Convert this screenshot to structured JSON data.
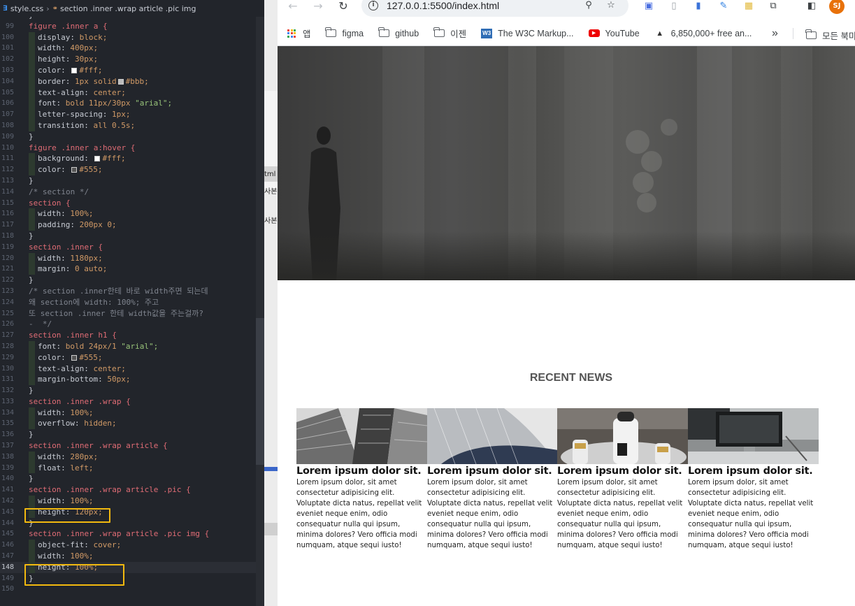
{
  "editor": {
    "breadcrumb": {
      "file": "style.css",
      "selector": "section .inner .wrap article .pic img"
    },
    "lines": [
      {
        "n": "98",
        "text": "}"
      },
      {
        "n": "99",
        "sel": "figure .inner a {"
      },
      {
        "n": "100",
        "prop": "display:",
        "val": "block;"
      },
      {
        "n": "101",
        "prop": "width:",
        "val": "400px;"
      },
      {
        "n": "102",
        "prop": "height:",
        "val": "30px;"
      },
      {
        "n": "103",
        "prop": "color:",
        "swatch": "#ffffff",
        "val": "#fff;"
      },
      {
        "n": "104",
        "prop": "border:",
        "val": "1px solid",
        "swatch": "#bbbbbb",
        "val2": "#bbb;"
      },
      {
        "n": "105",
        "prop": "text-align:",
        "val": "center;"
      },
      {
        "n": "106",
        "prop": "font:",
        "val": "bold 11px/30px",
        "str": "\"arial\";"
      },
      {
        "n": "107",
        "prop": "letter-spacing:",
        "val": "1px;"
      },
      {
        "n": "108",
        "prop": "transition:",
        "val": "all 0.5s;"
      },
      {
        "n": "109",
        "text": "}"
      },
      {
        "n": "110",
        "sel": "figure .inner a:hover {"
      },
      {
        "n": "111",
        "prop": "background:",
        "swatch": "#ffffff",
        "val": "#fff;"
      },
      {
        "n": "112",
        "prop": "color:",
        "swatch": "#555555",
        "val": "#555;"
      },
      {
        "n": "113",
        "text": "}"
      },
      {
        "n": "114",
        "comment": "/* section */"
      },
      {
        "n": "115",
        "sel": "section {"
      },
      {
        "n": "116",
        "prop": "width:",
        "val": "100%;"
      },
      {
        "n": "117",
        "prop": "padding:",
        "val": "200px 0;"
      },
      {
        "n": "118",
        "text": "}"
      },
      {
        "n": "119",
        "sel": "section .inner {"
      },
      {
        "n": "120",
        "prop": "width:",
        "val": "1180px;"
      },
      {
        "n": "121",
        "prop": "margin:",
        "val": "0 auto;"
      },
      {
        "n": "122",
        "text": "}"
      },
      {
        "n": "123",
        "comment": "/* section .inner한테 바로 width주면 되는데"
      },
      {
        "n": "124",
        "comment": "왜 section에 width: 100%; 주고"
      },
      {
        "n": "125",
        "comment": "또 section .inner 한테 width값을 주는걸까?"
      },
      {
        "n": "126",
        "comment": "-  */"
      },
      {
        "n": "127",
        "sel": "section .inner h1 {"
      },
      {
        "n": "128",
        "prop": "font:",
        "val": "bold 24px/1",
        "str": "\"arial\";"
      },
      {
        "n": "129",
        "prop": "color:",
        "swatch": "#555555",
        "val": "#555;"
      },
      {
        "n": "130",
        "prop": "text-align:",
        "val": "center;"
      },
      {
        "n": "131",
        "prop": "margin-bottom:",
        "val": "50px;"
      },
      {
        "n": "132",
        "text": "}"
      },
      {
        "n": "133",
        "sel": "section .inner .wrap {"
      },
      {
        "n": "134",
        "prop": "width:",
        "val": "100%;"
      },
      {
        "n": "135",
        "prop": "overflow:",
        "val": "hidden;"
      },
      {
        "n": "136",
        "text": "}"
      },
      {
        "n": "137",
        "sel": "section .inner .wrap article {"
      },
      {
        "n": "138",
        "prop": "width:",
        "val": "280px;"
      },
      {
        "n": "139",
        "prop": "float:",
        "val": "left;"
      },
      {
        "n": "140",
        "text": "}"
      },
      {
        "n": "141",
        "sel": "section .inner .wrap article .pic {"
      },
      {
        "n": "142",
        "prop": "width:",
        "val": "100%;"
      },
      {
        "n": "143",
        "prop": "height:",
        "val": "120px;"
      },
      {
        "n": "144",
        "text": "}"
      },
      {
        "n": "145",
        "sel": "section .inner .wrap article .pic img {"
      },
      {
        "n": "146",
        "prop": "object-fit:",
        "val": "cover;"
      },
      {
        "n": "147",
        "prop": "width:",
        "val": "100%;"
      },
      {
        "n": "148",
        "prop": "height:",
        "val": "100%;",
        "active": true
      },
      {
        "n": "149",
        "text": "}"
      },
      {
        "n": "150",
        "text": ""
      }
    ]
  },
  "strip": {
    "text1": "tml",
    "text2": "사본",
    "text3": "사본"
  },
  "browser": {
    "url": "127.0.0.1:5500/index.html",
    "profile_initials": "SJ",
    "bookmarks": [
      {
        "label": "앱",
        "icon": "apps-grid-icon"
      },
      {
        "label": "figma",
        "icon": "folder-icon"
      },
      {
        "label": "github",
        "icon": "folder-icon"
      },
      {
        "label": "이젠",
        "icon": "folder-icon"
      },
      {
        "label": "The W3C Markup...",
        "icon": "w3c-icon"
      },
      {
        "label": "YouTube",
        "icon": "youtube-icon"
      },
      {
        "label": "6,850,000+ free an...",
        "icon": "site-icon"
      }
    ],
    "more_bookmarks": "»",
    "all_bookmarks": "모든 북마"
  },
  "page": {
    "heading": "RECENT NEWS",
    "articles": [
      {
        "title": "Lorem ipsum dolor sit.",
        "body": "Lorem ipsum dolor, sit amet consectetur adipisicing elit. Voluptate dicta natus, repellat velit eveniet neque enim, odio consequatur nulla qui ipsum, minima dolores? Vero officia modi numquam, atque sequi iusto!"
      },
      {
        "title": "Lorem ipsum dolor sit.",
        "body": "Lorem ipsum dolor, sit amet consectetur adipisicing elit. Voluptate dicta natus, repellat velit eveniet neque enim, odio consequatur nulla qui ipsum, minima dolores? Vero officia modi numquam, atque sequi iusto!"
      },
      {
        "title": "Lorem ipsum dolor sit.",
        "body": "Lorem ipsum dolor, sit amet consectetur adipisicing elit. Voluptate dicta natus, repellat velit eveniet neque enim, odio consequatur nulla qui ipsum, minima dolores? Vero officia modi numquam, atque sequi iusto!"
      },
      {
        "title": "Lorem ipsum dolor sit.",
        "body": "Lorem ipsum dolor, sit amet consectetur adipisicing elit. Voluptate dicta natus, repellat velit eveniet neque enim, odio consequatur nulla qui ipsum, minima dolores? Vero officia modi numquam, atque sequi iusto!"
      }
    ]
  },
  "colors": {
    "highlight_box": "#f2b90f",
    "editor_bg": "#22252b",
    "heading": "#555555"
  }
}
